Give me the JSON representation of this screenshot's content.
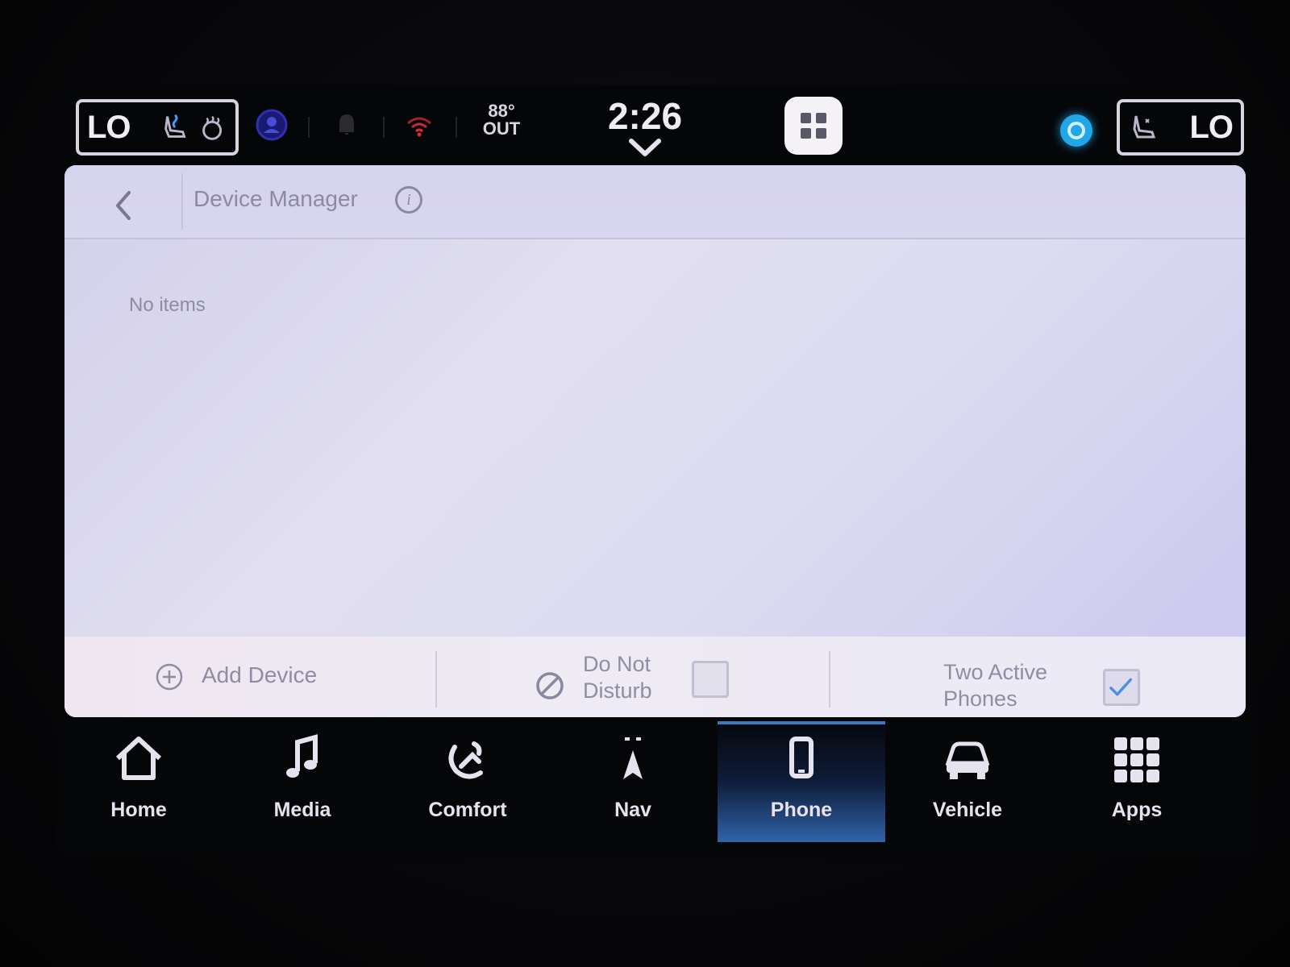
{
  "statusbar": {
    "left_temp": "LO",
    "right_temp": "LO",
    "outside_temp": "88°",
    "outside_label": "OUT",
    "clock": "2:26",
    "icons": [
      "seat-heat-icon",
      "steering-heat-icon",
      "driver-profile-icon",
      "bell-icon",
      "wifi-icon",
      "app-grid-icon",
      "alexa-icon",
      "seat-cool-icon"
    ]
  },
  "header": {
    "title": "Device Manager"
  },
  "content": {
    "empty_message": "No items"
  },
  "footer": {
    "add_device_label": "Add Device",
    "dnd_label_line1": "Do Not",
    "dnd_label_line2": "Disturb",
    "dnd_checked": false,
    "two_phones_line1": "Two Active",
    "two_phones_line2": "Phones",
    "two_phones_checked": true
  },
  "nav": {
    "items": [
      {
        "label": "Home",
        "icon": "home-icon"
      },
      {
        "label": "Media",
        "icon": "music-note-icon"
      },
      {
        "label": "Comfort",
        "icon": "comfort-icon"
      },
      {
        "label": "Nav",
        "icon": "navigation-arrow-icon"
      },
      {
        "label": "Phone",
        "icon": "phone-icon",
        "active": true
      },
      {
        "label": "Vehicle",
        "icon": "vehicle-icon"
      },
      {
        "label": "Apps",
        "icon": "apps-grid-icon"
      }
    ]
  },
  "colors": {
    "accent": "#3f76c4",
    "panel": "#dedcf0",
    "text_muted": "#8f8da4",
    "check": "#4f8fe0"
  }
}
